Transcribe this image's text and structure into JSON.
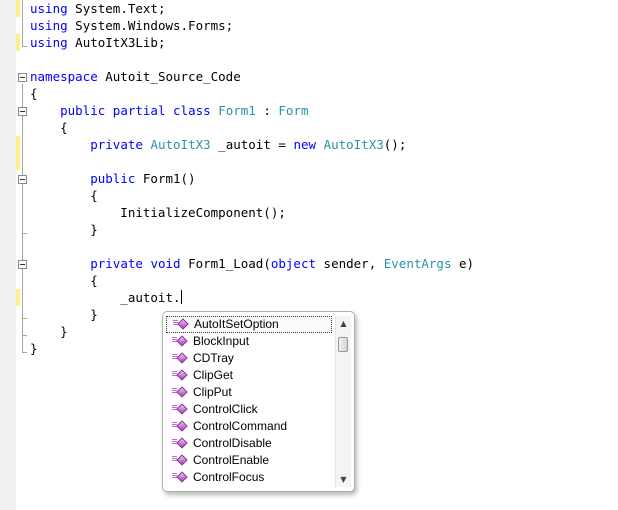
{
  "editor": {
    "lines": [
      {
        "segments": [
          {
            "text": "using",
            "style": "kw"
          },
          {
            "text": " System.Text;",
            "style": "plain"
          }
        ]
      },
      {
        "segments": [
          {
            "text": "using",
            "style": "kw"
          },
          {
            "text": " System.Windows.Forms;",
            "style": "plain"
          }
        ]
      },
      {
        "segments": [
          {
            "text": "using",
            "style": "kw"
          },
          {
            "text": " AutoItX3Lib;",
            "style": "plain"
          }
        ]
      },
      {
        "segments": []
      },
      {
        "segments": [
          {
            "text": "namespace",
            "style": "kw"
          },
          {
            "text": " Autoit_Source_Code",
            "style": "plain"
          }
        ]
      },
      {
        "segments": [
          {
            "text": "{",
            "style": "plain"
          }
        ]
      },
      {
        "segments": [
          {
            "text": "    ",
            "style": "plain"
          },
          {
            "text": "public",
            "style": "kw"
          },
          {
            "text": " ",
            "style": "plain"
          },
          {
            "text": "partial",
            "style": "kw"
          },
          {
            "text": " ",
            "style": "plain"
          },
          {
            "text": "class",
            "style": "kw"
          },
          {
            "text": " ",
            "style": "plain"
          },
          {
            "text": "Form1",
            "style": "ty"
          },
          {
            "text": " : ",
            "style": "plain"
          },
          {
            "text": "Form",
            "style": "ty"
          }
        ]
      },
      {
        "segments": [
          {
            "text": "    {",
            "style": "plain"
          }
        ]
      },
      {
        "segments": [
          {
            "text": "        ",
            "style": "plain"
          },
          {
            "text": "private",
            "style": "kw"
          },
          {
            "text": " ",
            "style": "plain"
          },
          {
            "text": "AutoItX3",
            "style": "ty"
          },
          {
            "text": " _autoit = ",
            "style": "plain"
          },
          {
            "text": "new",
            "style": "kw"
          },
          {
            "text": " ",
            "style": "plain"
          },
          {
            "text": "AutoItX3",
            "style": "ty"
          },
          {
            "text": "();",
            "style": "plain"
          }
        ]
      },
      {
        "segments": []
      },
      {
        "segments": [
          {
            "text": "        ",
            "style": "plain"
          },
          {
            "text": "public",
            "style": "kw"
          },
          {
            "text": " Form1()",
            "style": "plain"
          }
        ]
      },
      {
        "segments": [
          {
            "text": "        {",
            "style": "plain"
          }
        ]
      },
      {
        "segments": [
          {
            "text": "            InitializeComponent();",
            "style": "plain"
          }
        ]
      },
      {
        "segments": [
          {
            "text": "        }",
            "style": "plain"
          }
        ]
      },
      {
        "segments": []
      },
      {
        "segments": [
          {
            "text": "        ",
            "style": "plain"
          },
          {
            "text": "private",
            "style": "kw"
          },
          {
            "text": " ",
            "style": "plain"
          },
          {
            "text": "void",
            "style": "kw"
          },
          {
            "text": " Form1_Load(",
            "style": "plain"
          },
          {
            "text": "object",
            "style": "kw"
          },
          {
            "text": " sender, ",
            "style": "plain"
          },
          {
            "text": "EventArgs",
            "style": "ty"
          },
          {
            "text": " e)",
            "style": "plain"
          }
        ]
      },
      {
        "segments": [
          {
            "text": "        {",
            "style": "plain"
          }
        ]
      },
      {
        "segments": [
          {
            "text": "            _autoit.",
            "style": "plain"
          }
        ],
        "cursor": true
      },
      {
        "segments": [
          {
            "text": "        }",
            "style": "plain"
          }
        ]
      },
      {
        "segments": [
          {
            "text": "    }",
            "style": "plain"
          }
        ]
      },
      {
        "segments": [
          {
            "text": "}",
            "style": "plain"
          }
        ]
      }
    ]
  },
  "intellisense": {
    "items": [
      {
        "label": "AutoItSetOption",
        "selected": true
      },
      {
        "label": "BlockInput"
      },
      {
        "label": "CDTray"
      },
      {
        "label": "ClipGet"
      },
      {
        "label": "ClipPut"
      },
      {
        "label": "ControlClick"
      },
      {
        "label": "ControlCommand"
      },
      {
        "label": "ControlDisable"
      },
      {
        "label": "ControlEnable"
      },
      {
        "label": "ControlFocus"
      }
    ],
    "icon": "method-icon",
    "scroll_up_glyph": "▲",
    "scroll_down_glyph": "▼"
  },
  "colors": {
    "keyword": "#0000ff",
    "type": "#2b91af",
    "text": "#000000",
    "changed_line_marker": "#ffef8c",
    "method_icon": "#b46fc0"
  }
}
